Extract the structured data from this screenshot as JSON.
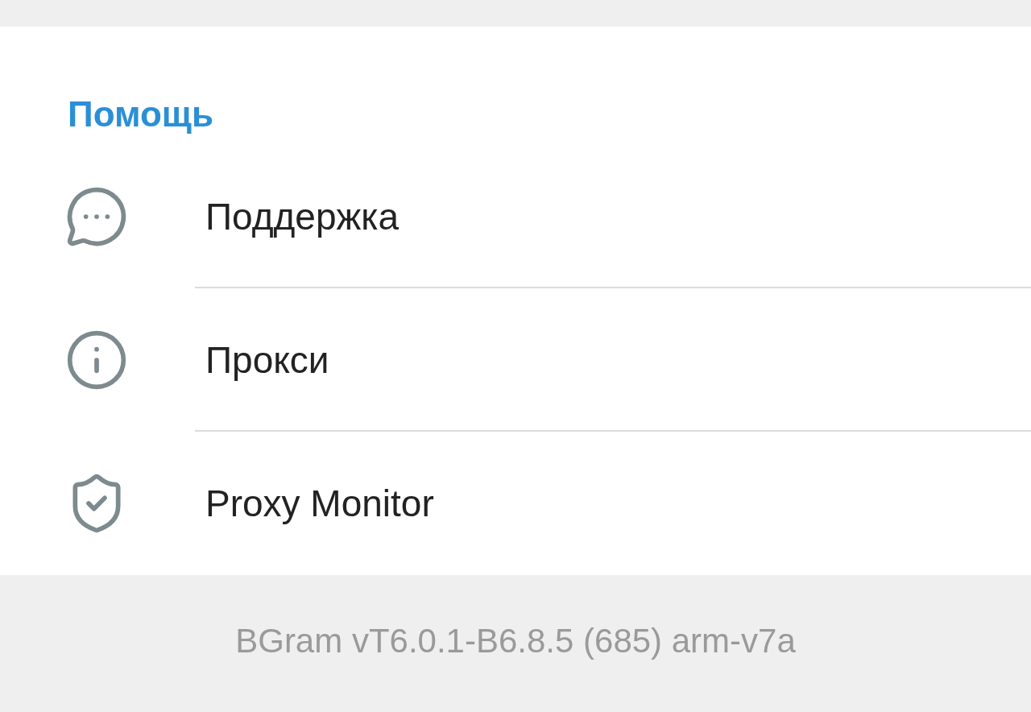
{
  "section": {
    "title": "Помощь",
    "items": [
      {
        "label": "Поддержка"
      },
      {
        "label": "Прокси"
      },
      {
        "label": "Proxy Monitor"
      }
    ]
  },
  "footer": {
    "version": "BGram vT6.0.1-B6.8.5 (685) arm-v7a"
  }
}
